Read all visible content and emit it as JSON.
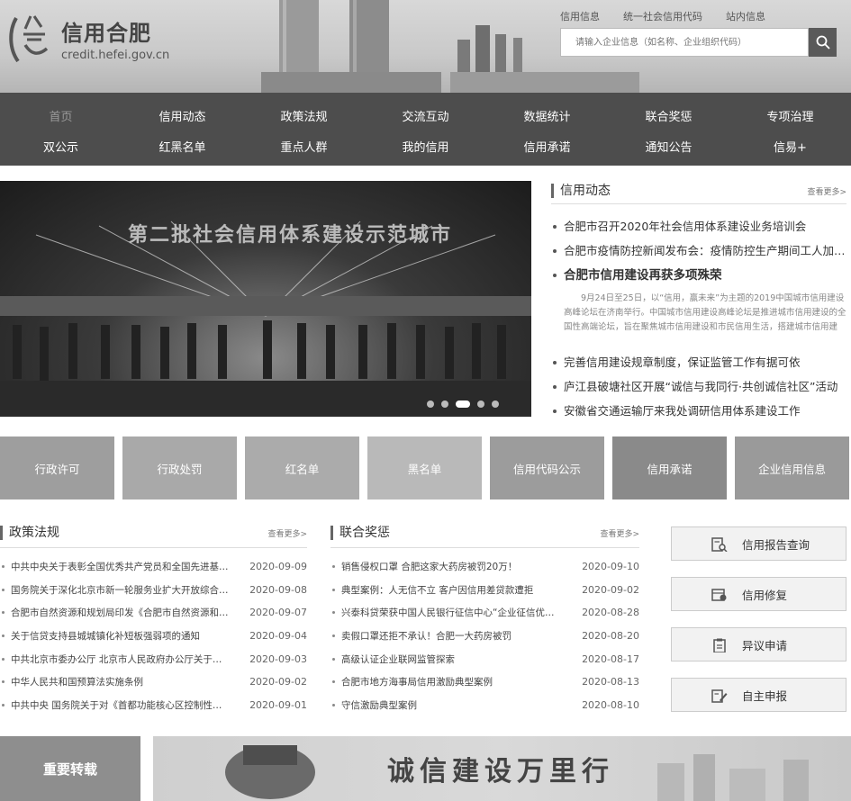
{
  "brand": {
    "title": "信用合肥",
    "url": "credit.hefei.gov.cn"
  },
  "top_links": [
    "信用信息",
    "统一社会信用代码",
    "站内信息"
  ],
  "search": {
    "placeholder": "请输入企业信息（如名称、企业组织代码）"
  },
  "nav": {
    "row1": [
      "首页",
      "信用动态",
      "政策法规",
      "交流互动",
      "数据统计",
      "联合奖惩",
      "专项治理"
    ],
    "row2": [
      "双公示",
      "红黑名单",
      "重点人群",
      "我的信用",
      "信用承诺",
      "通知公告",
      "信易+"
    ]
  },
  "banner": {
    "caption": "第二批社会信用体系建设示范城市"
  },
  "news": {
    "title": "信用动态",
    "more": "查看更多>",
    "items_top": [
      "合肥市召开2020年社会信用体系建设业务培训会",
      "合肥市疫情防控新闻发布会：疫情防控生产期间工人加班费标准"
    ],
    "headline": "合肥市信用建设再获多项殊荣",
    "summary": "9月24日至25日，以“信用，赢未来”为主题的2019中国城市信用建设高峰论坛在济南举行。中国城市信用建设高峰论坛是推进城市信用建设的全国性高端论坛，旨在聚焦城市信用建设和市民信用生活，搭建城市信用建设…",
    "items_bottom": [
      "完善信用建设规章制度，保证监管工作有据可依",
      "庐江县破塘社区开展“诚信与我同行·共创诚信社区”活动",
      "安徽省交通运输厅来我处调研信用体系建设工作"
    ]
  },
  "tiles": [
    {
      "label": "行政许可",
      "color": "#9e9e9e"
    },
    {
      "label": "行政处罚",
      "color": "#a9a9a9"
    },
    {
      "label": "红名单",
      "color": "#ababab"
    },
    {
      "label": "黑名单",
      "color": "#b9b9b9"
    },
    {
      "label": "信用代码公示",
      "color": "#9c9c9c"
    },
    {
      "label": "信用承诺",
      "color": "#8a8a8a"
    },
    {
      "label": "企业信用信息",
      "color": "#9a9a9a"
    }
  ],
  "policy": {
    "title": "政策法规",
    "more": "查看更多>",
    "rows": [
      {
        "text": "中共中央关于表彰全国优秀共产党员和全国先进基层党组织的决定",
        "date": "2020-09-09"
      },
      {
        "text": "国务院关于深化北京市新一轮服务业扩大开放综合试点",
        "date": "2020-09-08"
      },
      {
        "text": "合肥市自然资源和规划局印发《合肥市自然资源和规划》",
        "date": "2020-09-07"
      },
      {
        "text": "关于信贷支持县城城镇化补短板强弱项的通知",
        "date": "2020-09-04"
      },
      {
        "text": "中共北京市委办公厅 北京市人民政府办公厅关于印发",
        "date": "2020-09-03"
      },
      {
        "text": "中华人民共和国预算法实施条例",
        "date": "2020-09-02"
      },
      {
        "text": "中共中央 国务院关于对《首都功能核心区控制性详细规划》",
        "date": "2020-09-01"
      }
    ]
  },
  "rewards": {
    "title": "联合奖惩",
    "more": "查看更多>",
    "rows": [
      {
        "text": "销售侵权口罩 合肥这家大药房被罚20万！",
        "date": "2020-09-10"
      },
      {
        "text": "典型案例：人无信不立 客户因信用差贷款遭拒",
        "date": "2020-09-02"
      },
      {
        "text": "兴泰科贷荣获中国人民银行征信中心“企业征信优秀机构”",
        "date": "2020-08-28"
      },
      {
        "text": "卖假口罩还拒不承认！合肥一大药房被罚",
        "date": "2020-08-20"
      },
      {
        "text": "高级认证企业联网监管探索",
        "date": "2020-08-17"
      },
      {
        "text": "合肥市地方海事局信用激励典型案例",
        "date": "2020-08-13"
      },
      {
        "text": "守信激励典型案例",
        "date": "2020-08-10"
      }
    ]
  },
  "side_buttons": [
    {
      "label": "信用报告查询",
      "icon": "report-search-icon"
    },
    {
      "label": "信用修复",
      "icon": "repair-icon"
    },
    {
      "label": "异议申请",
      "icon": "clipboard-icon"
    },
    {
      "label": "自主申报",
      "icon": "edit-icon"
    }
  ],
  "bottom": {
    "repost": "重要转载",
    "slogan": "诚信建设万里行"
  }
}
